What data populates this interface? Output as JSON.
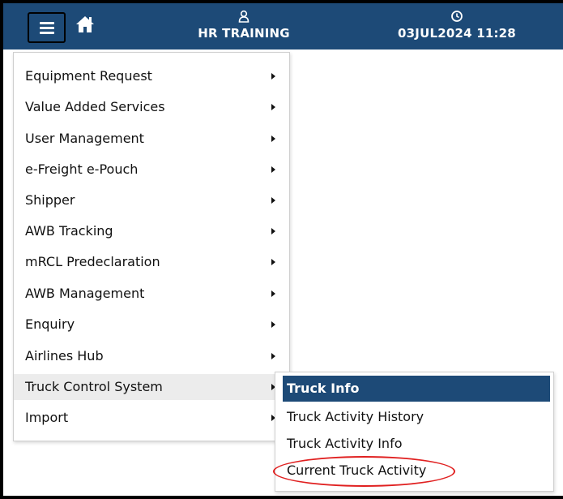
{
  "header": {
    "menu_icon": "hamburger-icon",
    "home_icon": "home-icon",
    "user_icon": "user-icon",
    "user_name": "HR TRAINING",
    "clock_icon": "clock-icon",
    "datetime": "03JUL2024 11:28",
    "bar_color": "#1d4a77"
  },
  "menu": {
    "items": [
      {
        "label": "Equipment Request"
      },
      {
        "label": "Value Added Services"
      },
      {
        "label": "User Management"
      },
      {
        "label": "e-Freight e-Pouch"
      },
      {
        "label": "Shipper"
      },
      {
        "label": "AWB Tracking"
      },
      {
        "label": "mRCL Predeclaration"
      },
      {
        "label": "AWB Management"
      },
      {
        "label": "Enquiry"
      },
      {
        "label": "Airlines Hub"
      },
      {
        "label": "Truck Control System"
      },
      {
        "label": "Import"
      }
    ],
    "active_item": "Truck Control System",
    "arrow_icon": "caret-right-icon"
  },
  "submenu": {
    "items": [
      {
        "label": "Truck Info"
      },
      {
        "label": "Truck Activity History"
      },
      {
        "label": "Truck Activity Info"
      },
      {
        "label": "Current Truck Activity"
      }
    ],
    "selected_item": "Truck Info",
    "selected_color": "#1d4a77",
    "annotation_color": "#e02020"
  }
}
